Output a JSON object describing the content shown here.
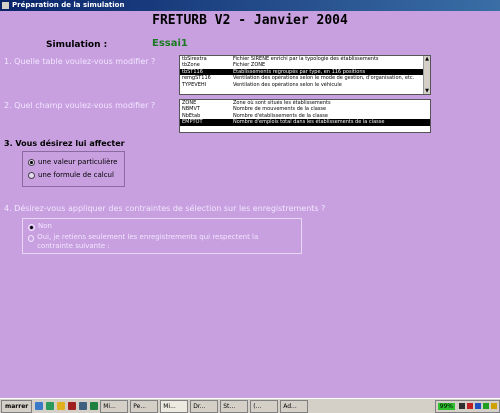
{
  "window": {
    "title": "Préparation de la simulation"
  },
  "header": {
    "title": "FRETURB V2 - Janvier 2004"
  },
  "simulation": {
    "label": "Simulation :",
    "value": "Essai1"
  },
  "q1": {
    "text": "1. Quelle table voulez-vous modifier ?",
    "rows": [
      {
        "name": "tbSirextra",
        "desc": "Fichier SIRENE enrichi par la typologie des établissements",
        "selected": false
      },
      {
        "name": "tbZone",
        "desc": "Fichier ZONE",
        "selected": false
      },
      {
        "name": "tbST116",
        "desc": "Etablissements regroupés par type, en 116 positions",
        "selected": true
      },
      {
        "name": "remgST116",
        "desc": "Ventilation des opérations selon le mode de gestion, d'organisation, etc.",
        "selected": false
      },
      {
        "name": "TYPEVEHI",
        "desc": "Ventilation des opérations selon le véhicule",
        "selected": false
      }
    ]
  },
  "q2": {
    "text": "2. Quel champ voulez-vous modifier ?",
    "rows": [
      {
        "name": "ZONE",
        "desc": "Zone où sont situés les établissements",
        "selected": false
      },
      {
        "name": "NBMVT",
        "desc": "Nombre de mouvements de la classe",
        "selected": false
      },
      {
        "name": "NbEtab",
        "desc": "Nombre d'établissements de la classe",
        "selected": false
      },
      {
        "name": "EMPTOT",
        "desc": "Nombre d'emplois total dans les établissements de la classe",
        "selected": true
      }
    ]
  },
  "q3": {
    "text": "3. Vous désirez lui affecter",
    "options": [
      "une valeur particulière",
      "une formule de calcul"
    ],
    "selected_index": 0
  },
  "q4": {
    "text": "4. Désirez-vous appliquer des contraintes de sélection sur les enregistrements ?",
    "options": [
      "Non",
      "Oui, je retiens seulement les enregistrements qui respectent la contrainte suivante :"
    ],
    "selected_index": 0
  },
  "taskbar": {
    "start_label": "marrer",
    "tasks": [
      "Mi...",
      "Pe...",
      "Mi...",
      "Dr...",
      "St...",
      "(...",
      "Ad..."
    ],
    "active_task_index": 2,
    "battery": "99%"
  }
}
